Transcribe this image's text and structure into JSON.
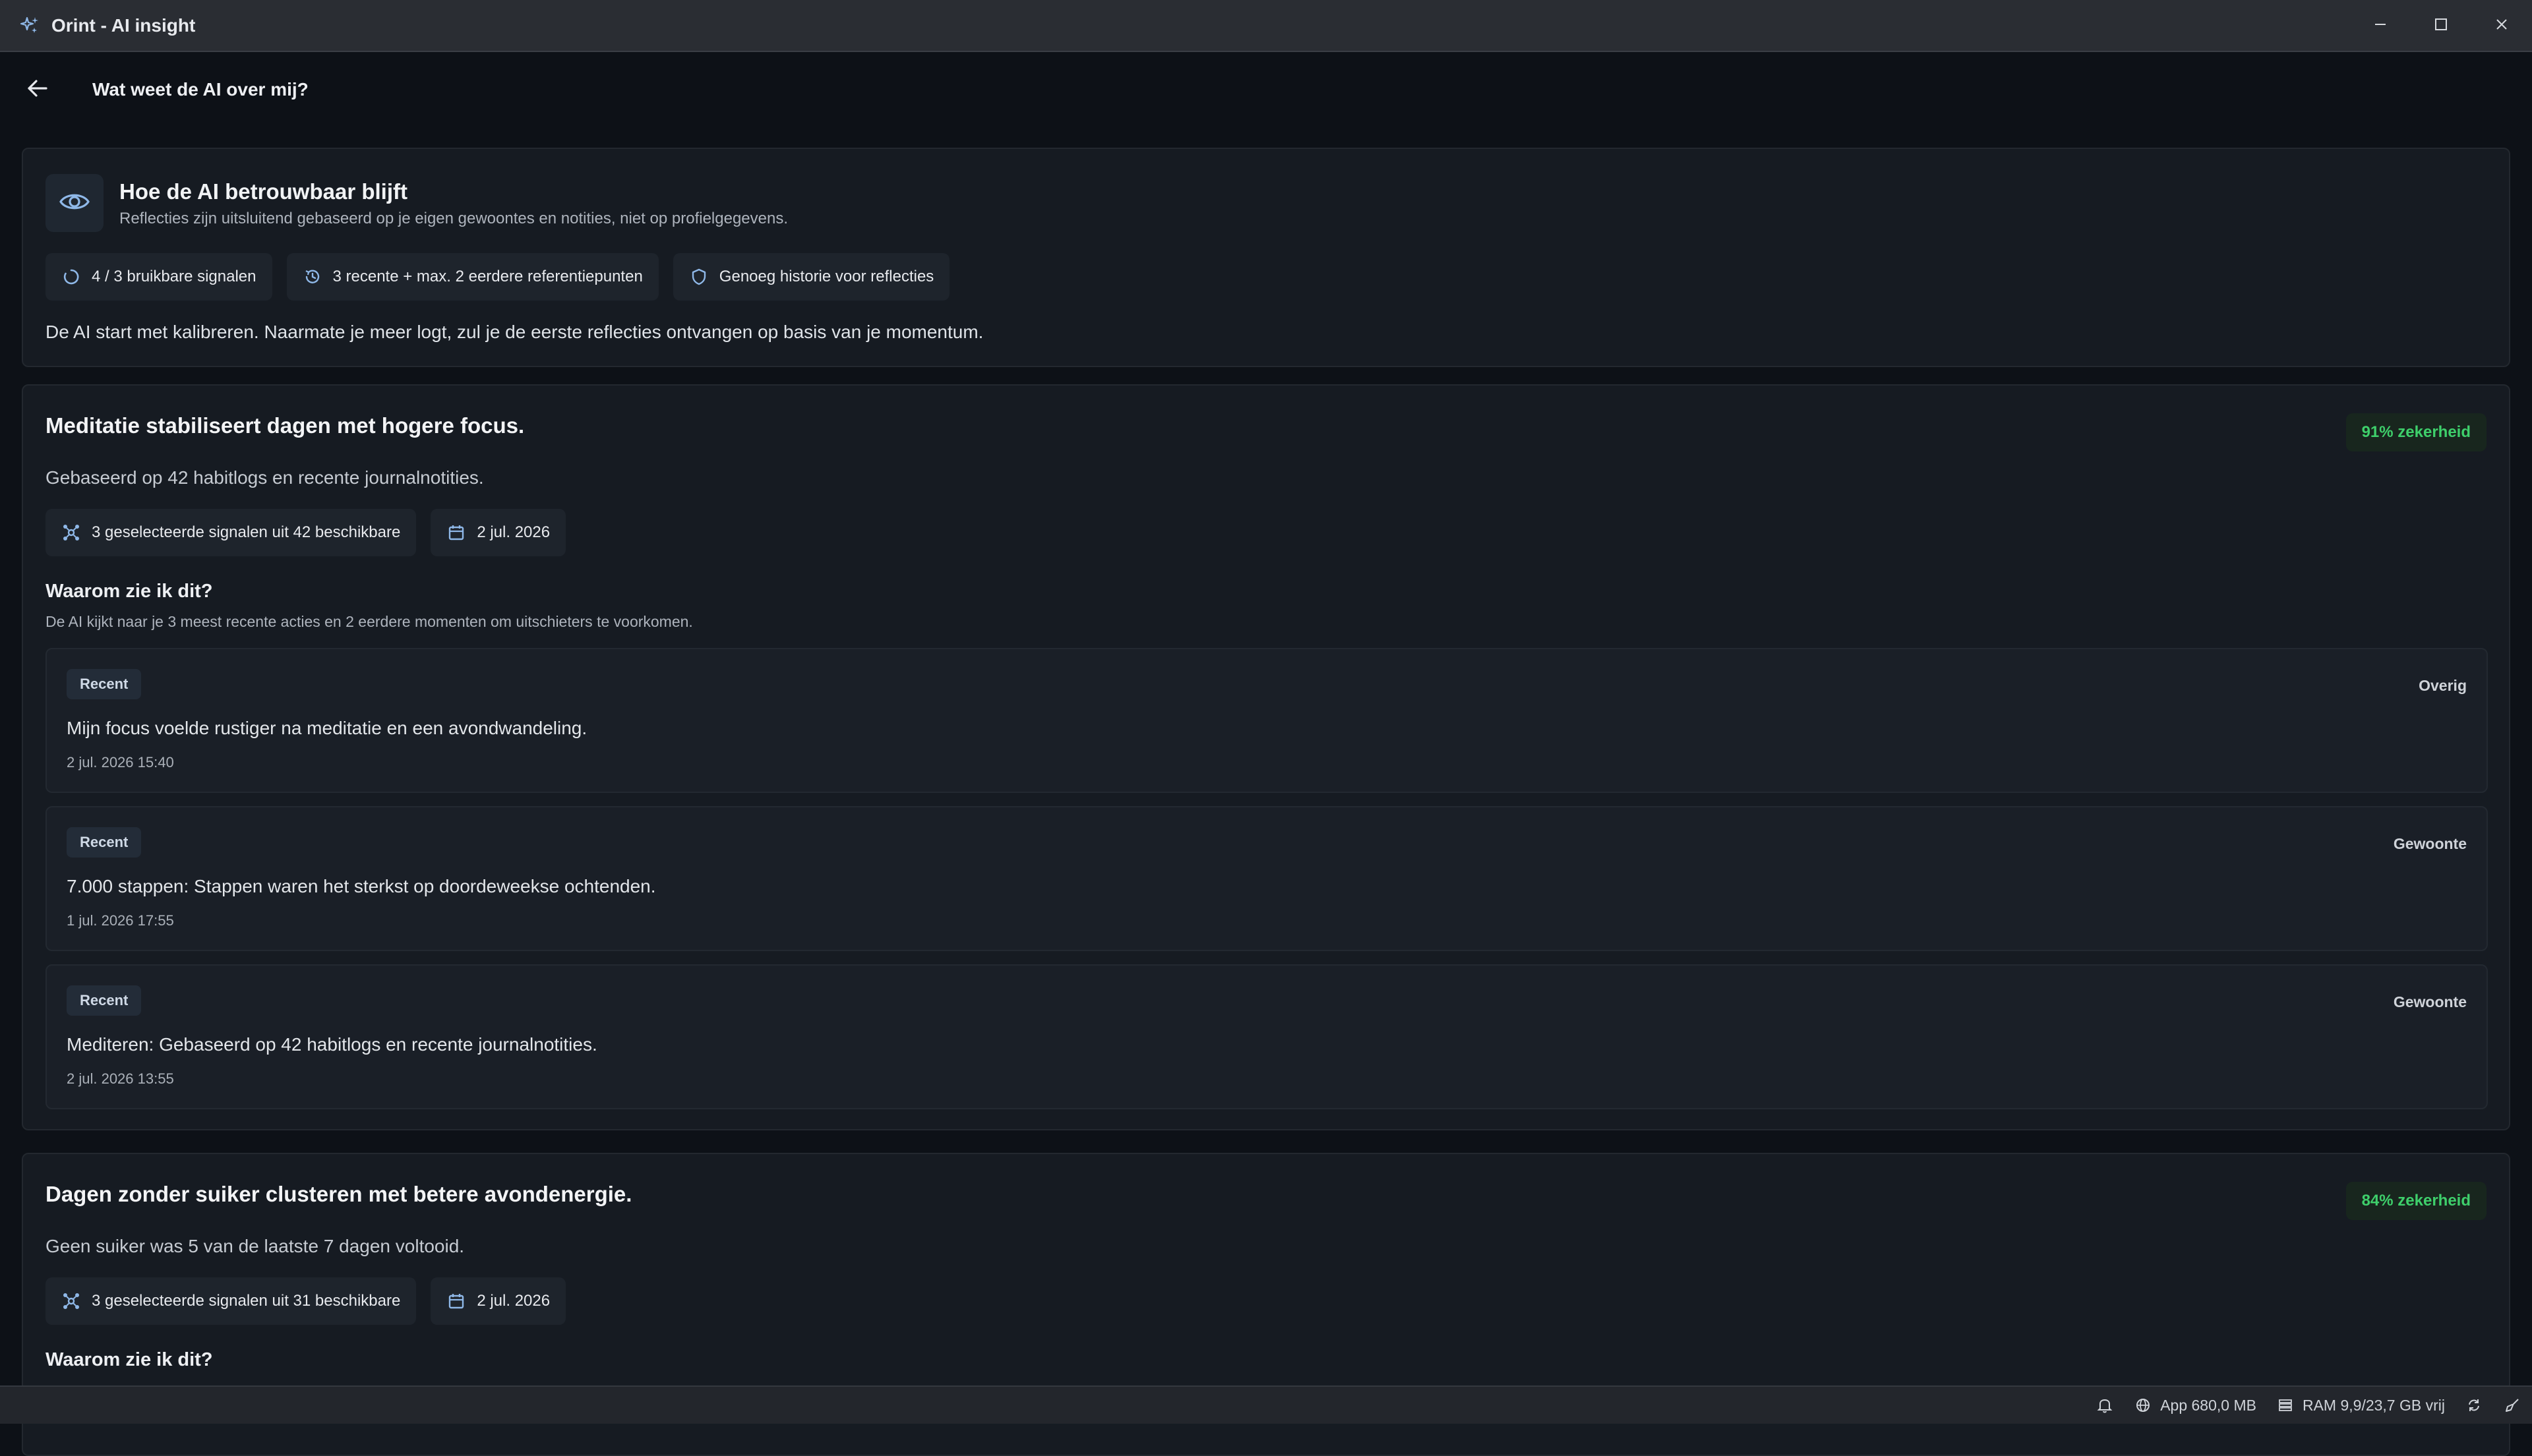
{
  "window": {
    "title": "Orint - AI insight"
  },
  "header": {
    "title": "Wat weet de AI over mij?"
  },
  "info": {
    "title": "Hoe de AI betrouwbaar blijft",
    "subtitle": "Reflecties zijn uitsluitend gebaseerd op je eigen gewoontes en notities, niet op profielgegevens.",
    "chips": [
      {
        "icon": "loader-icon",
        "label": "4 / 3 bruikbare signalen"
      },
      {
        "icon": "history-icon",
        "label": "3 recente + max. 2 eerdere referentiepunten"
      },
      {
        "icon": "shield-icon",
        "label": "Genoeg historie voor reflecties"
      }
    ],
    "text": "De AI start met kalibreren. Naarmate je meer logt, zul je de eerste reflecties ontvangen op basis van je momentum."
  },
  "insights": [
    {
      "title": "Meditatie stabiliseert dagen met hogere focus.",
      "confidence": "91% zekerheid",
      "description": "Gebaseerd op 42 habitlogs en recente journalnotities.",
      "signals_chip": "3 geselecteerde signalen uit 42 beschikbare",
      "date_chip": "2 jul. 2026",
      "why_title": "Waarom zie ik dit?",
      "why_sub": "De AI kijkt naar je 3 meest recente acties en 2 eerdere momenten om uitschieters te voorkomen.",
      "signals": [
        {
          "badge": "Recent",
          "category": "Overig",
          "text": "Mijn focus voelde rustiger na meditatie en een avondwandeling.",
          "time": "2 jul. 2026 15:40"
        },
        {
          "badge": "Recent",
          "category": "Gewoonte",
          "text": "7.000 stappen: Stappen waren het sterkst op doordeweekse ochtenden.",
          "time": "1 jul. 2026 17:55"
        },
        {
          "badge": "Recent",
          "category": "Gewoonte",
          "text": "Mediteren: Gebaseerd op 42 habitlogs en recente journalnotities.",
          "time": "2 jul. 2026 13:55"
        }
      ]
    },
    {
      "title": "Dagen zonder suiker clusteren met betere avondenergie.",
      "confidence": "84% zekerheid",
      "description": "Geen suiker was 5 van de laatste 7 dagen voltooid.",
      "signals_chip": "3 geselecteerde signalen uit 31 beschikbare",
      "date_chip": "2 jul. 2026",
      "why_title": "Waarom zie ik dit?"
    }
  ],
  "statusbar": {
    "app_memory": "App 680,0 MB",
    "ram": "RAM 9,9/23,7 GB vrij"
  },
  "colors": {
    "background": "#0d1117",
    "card": "#161b22",
    "confidence_green": "#3ecf6b",
    "accent_blue": "#8fb8e8"
  }
}
